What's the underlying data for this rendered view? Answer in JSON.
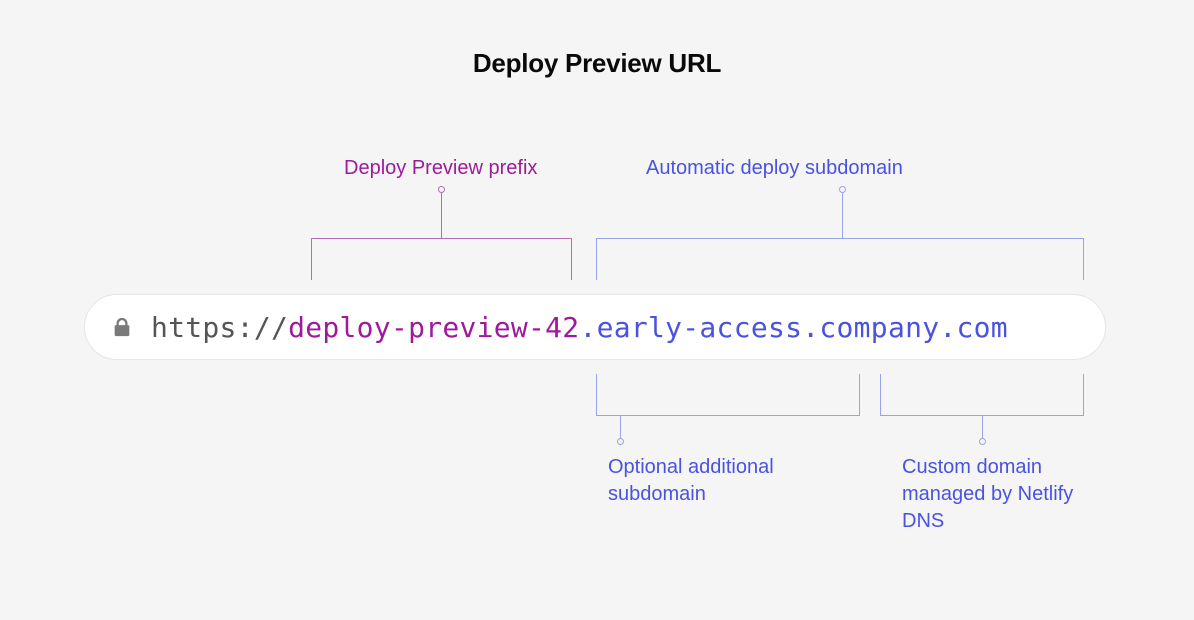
{
  "title": "Deploy Preview URL",
  "url": {
    "scheme": "https://",
    "prefix": "deploy-preview-42",
    "dot1": ".",
    "subdomain": "early-access",
    "dot2": ".",
    "domain": "company.com"
  },
  "callouts": {
    "prefix": "Deploy Preview prefix",
    "autoSubdomain": "Automatic deploy subdomain",
    "optionalSubdomain": "Optional additional subdomain",
    "customDomain": "Custom domain managed by Netlify DNS"
  },
  "colors": {
    "purple": "#9e1a9a",
    "indigo": "#4a52e0",
    "scheme": "#555555",
    "bracketPurple": "#b36fb0",
    "bracketIndigo": "#9aa2e8"
  }
}
